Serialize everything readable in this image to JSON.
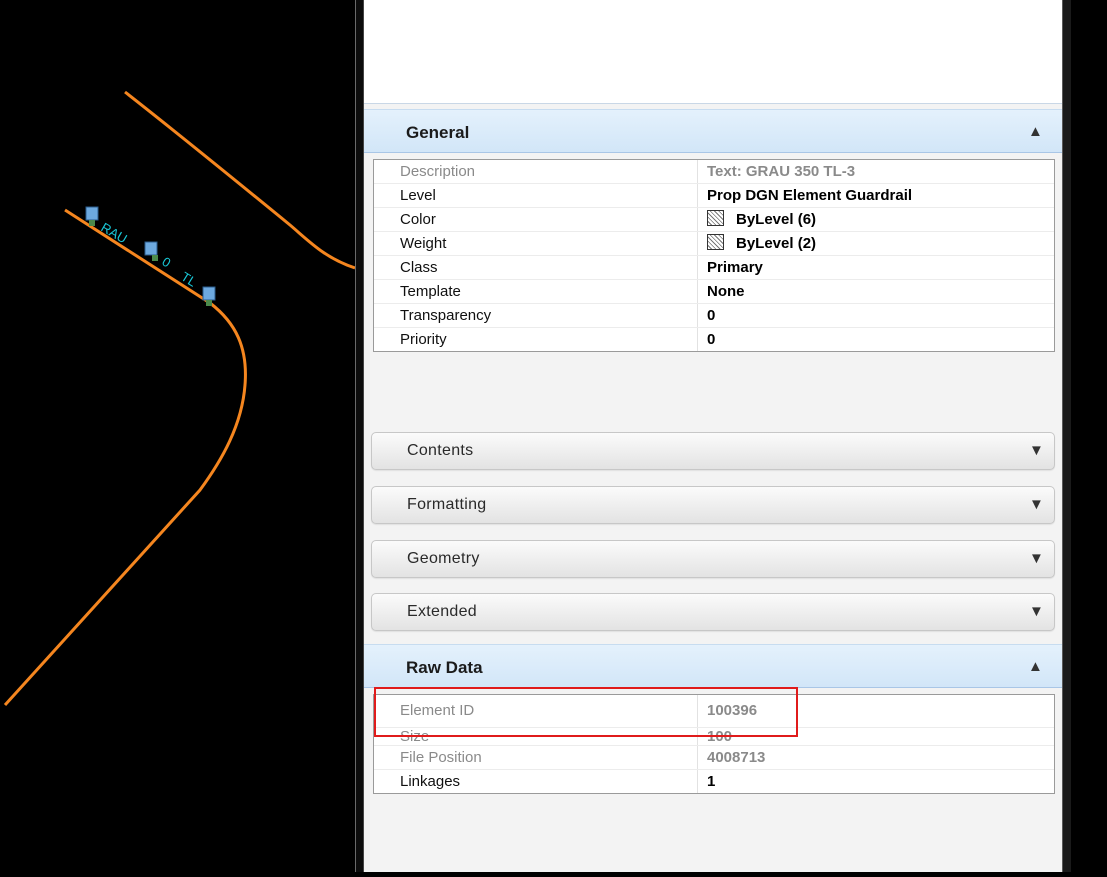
{
  "colors": {
    "route_line": "#f5861f",
    "cad_text": "#19c7d6",
    "panel_header": "#d6e9fb",
    "highlight": "#e01b1b"
  },
  "canvas": {
    "labels": [
      "RAU",
      "0",
      "TL"
    ]
  },
  "sections": {
    "general": {
      "title": "General",
      "expanded": true,
      "chevron": "chevron-up-icon"
    },
    "contents": {
      "title": "Contents",
      "expanded": false,
      "chevron": "chevron-down-icon"
    },
    "formatting": {
      "title": "Formatting",
      "expanded": false,
      "chevron": "chevron-down-icon"
    },
    "geometry": {
      "title": "Geometry",
      "expanded": false,
      "chevron": "chevron-down-icon"
    },
    "extended": {
      "title": "Extended",
      "expanded": false,
      "chevron": "chevron-down-icon"
    },
    "raw_data": {
      "title": "Raw Data",
      "expanded": true,
      "chevron": "chevron-up-icon"
    }
  },
  "general_rows": [
    {
      "label": "Description",
      "value": "Text: GRAU 350 TL-3"
    },
    {
      "label": "Level",
      "value": "Prop DGN Element Guardrail"
    },
    {
      "label": "Color",
      "value": "ByLevel (6)"
    },
    {
      "label": "Weight",
      "value": "ByLevel (2)"
    },
    {
      "label": "Class",
      "value": "Primary"
    },
    {
      "label": "Template",
      "value": "None"
    },
    {
      "label": "Transparency",
      "value": "0"
    },
    {
      "label": "Priority",
      "value": "0"
    }
  ],
  "raw_rows": [
    {
      "label": "Element ID",
      "value": "100396"
    },
    {
      "label": "Size",
      "value": "100"
    },
    {
      "label": "File Position",
      "value": "4008713"
    },
    {
      "label": "Linkages",
      "value": "1"
    }
  ]
}
